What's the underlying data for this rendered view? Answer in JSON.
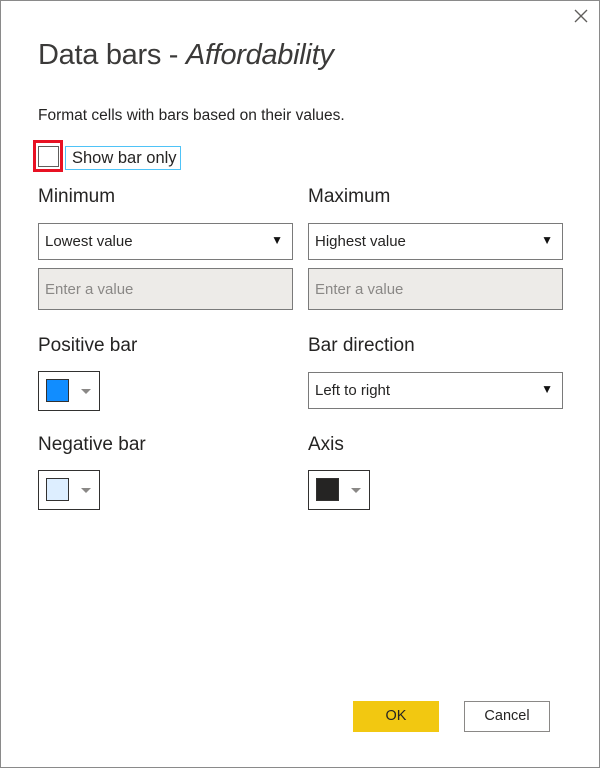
{
  "dialog": {
    "title_prefix": "Data bars - ",
    "title_field": "Affordability",
    "description": "Format cells with bars based on their values.",
    "close_icon": "close-icon"
  },
  "show_bar_only": {
    "label": "Show bar only",
    "checked": false
  },
  "minimum": {
    "label": "Minimum",
    "selected": "Lowest value",
    "value_placeholder": "Enter a value"
  },
  "maximum": {
    "label": "Maximum",
    "selected": "Highest value",
    "value_placeholder": "Enter a value"
  },
  "positive_bar": {
    "label": "Positive bar",
    "color": "#118dff"
  },
  "negative_bar": {
    "label": "Negative bar",
    "color": "#ddeeff"
  },
  "bar_direction": {
    "label": "Bar direction",
    "selected": "Left to right"
  },
  "axis": {
    "label": "Axis",
    "color": "#252423"
  },
  "buttons": {
    "ok": "OK",
    "cancel": "Cancel"
  },
  "colors": {
    "accent": "#f2c811",
    "highlight_border": "#e81123",
    "focus_border": "#4fc3f7"
  }
}
